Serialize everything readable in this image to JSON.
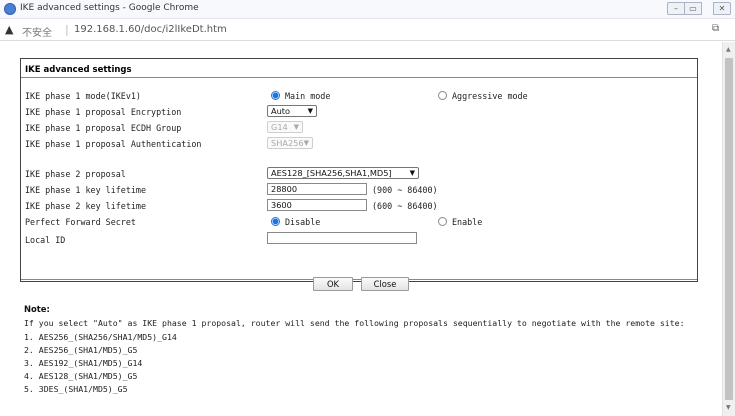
{
  "window": {
    "title": "IKE advanced settings - Google Chrome",
    "minimize_symbol": "–",
    "maximize_symbol": "▭",
    "close_symbol": "✕"
  },
  "address": {
    "warning_symbol": "▲",
    "insecure_label": "不安全",
    "separator": "|",
    "url": "192.168.1.60/doc/i2lIkeDt.htm",
    "extension_symbol": "⧉"
  },
  "panel": {
    "title": "IKE advanced settings"
  },
  "rows": {
    "phase1_mode": {
      "label": "IKE phase 1 mode(IKEv1)",
      "option_main": "Main mode",
      "option_aggressive": "Aggressive mode",
      "selected": "Main mode"
    },
    "phase1_encryption": {
      "label": "IKE phase 1 proposal Encryption",
      "value": "Auto"
    },
    "phase1_ecdh": {
      "label": "IKE phase 1 proposal ECDH Group",
      "value": "G14"
    },
    "phase1_auth": {
      "label": "IKE phase 1 proposal Authentication",
      "value": "SHA256"
    },
    "phase2_proposal": {
      "label": "IKE phase 2 proposal",
      "value": "AES128_[SHA256,SHA1,MD5]"
    },
    "phase1_lifetime": {
      "label": "IKE phase 1 key lifetime",
      "value": "28800",
      "range": "(900 ~ 86400)"
    },
    "phase2_lifetime": {
      "label": "IKE phase 2 key lifetime",
      "value": "3600",
      "range": "(600 ~ 86400)"
    },
    "pfs": {
      "label": "Perfect Forward Secret",
      "option_disable": "Disable",
      "option_enable": "Enable",
      "selected": "Disable"
    },
    "local_id": {
      "label": "Local ID",
      "value": ""
    }
  },
  "buttons": {
    "ok": "OK",
    "close": "Close"
  },
  "note": {
    "title": "Note:",
    "intro": "If you select \"Auto\" as IKE phase 1 proposal, router will send the following proposals sequentially to negotiate with the remote site:",
    "items": [
      "1. AES256_(SHA256/SHA1/MD5)_G14",
      "2. AES256_(SHA1/MD5)_G5",
      "3. AES192_(SHA1/MD5)_G14",
      "4. AES128_(SHA1/MD5)_G5",
      "5. 3DES_(SHA1/MD5)_G5"
    ]
  },
  "scrollbar": {
    "up_symbol": "▲",
    "down_symbol": "▼"
  }
}
